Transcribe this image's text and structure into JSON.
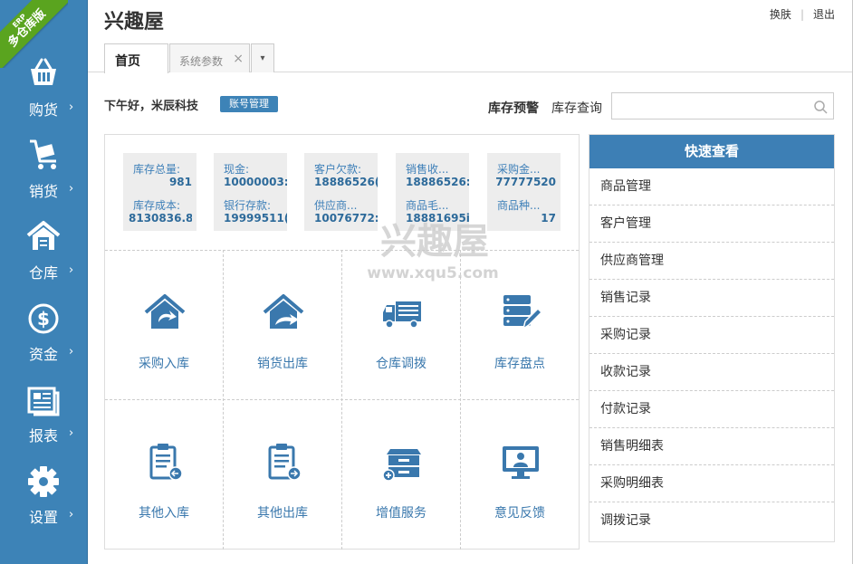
{
  "brand": {
    "ribbon_small": "ERP",
    "ribbon_big": "多仓库版"
  },
  "sidebar": {
    "items": [
      {
        "label": "购货",
        "icon": "basket-icon"
      },
      {
        "label": "销货",
        "icon": "cart-icon"
      },
      {
        "label": "仓库",
        "icon": "warehouse-icon"
      },
      {
        "label": "资金",
        "icon": "dollar-icon"
      },
      {
        "label": "报表",
        "icon": "report-icon"
      },
      {
        "label": "设置",
        "icon": "gear-icon"
      }
    ],
    "arrow": "›"
  },
  "header": {
    "title": "兴趣屋",
    "switch_skin": "换肤",
    "logout": "退出",
    "tabs": [
      {
        "label": "首页"
      },
      {
        "label": "系统参数",
        "close": "×"
      }
    ],
    "more": "▾"
  },
  "greeting": {
    "text": "下午好，米辰科技",
    "account_button": "账号管理"
  },
  "stock": {
    "alert": "库存预警",
    "query": "库存查询",
    "search_placeholder": ""
  },
  "stats": [
    {
      "l1": "库存总量:",
      "v1": "981",
      "l2": "库存成本:",
      "v2": "8130836.8"
    },
    {
      "l1": "现金:",
      "v1": "10000003:",
      "l2": "银行存款:",
      "v2": "19999511("
    },
    {
      "l1": "客户欠款:",
      "v1": "18886526(",
      "l2": "供应商...",
      "v2": "10076772:"
    },
    {
      "l1": "销售收...",
      "v1": "18886526:",
      "l2": "商品毛...",
      "v2": "18881695i"
    },
    {
      "l1": "采购金...",
      "v1": "77777520",
      "l2": "商品种...",
      "v2": "17"
    }
  ],
  "tiles": [
    {
      "label": "采购入库",
      "icon": "home-in-icon"
    },
    {
      "label": "销货出库",
      "icon": "home-out-icon"
    },
    {
      "label": "仓库调拨",
      "icon": "truck-icon"
    },
    {
      "label": "库存盘点",
      "icon": "database-edit-icon"
    },
    {
      "label": "其他入库",
      "icon": "clipboard-in-icon"
    },
    {
      "label": "其他出库",
      "icon": "clipboard-out-icon"
    },
    {
      "label": "增值服务",
      "icon": "cabinet-add-icon"
    },
    {
      "label": "意见反馈",
      "icon": "monitor-user-icon"
    }
  ],
  "watermark": {
    "title": "兴趣屋",
    "url": "www.xqu5.com"
  },
  "quick": {
    "header": "快速查看",
    "items": [
      "商品管理",
      "客户管理",
      "供应商管理",
      "销售记录",
      "采购记录",
      "收款记录",
      "付款记录",
      "销售明细表",
      "采购明细表",
      "调拨记录"
    ]
  },
  "colors": {
    "sidebar": "#3d83b7",
    "accent": "#3d7fb5",
    "ribbon": "#5aa41f",
    "tile_text": "#3a78ad"
  }
}
